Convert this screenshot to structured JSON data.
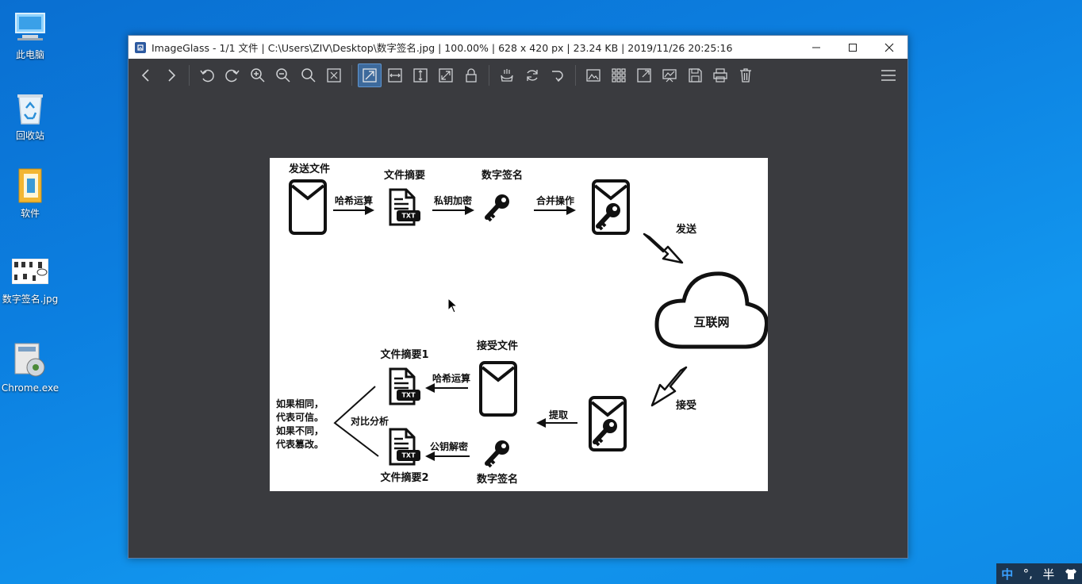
{
  "desktop": {
    "icons": [
      {
        "label": "此电脑"
      },
      {
        "label": "回收站"
      },
      {
        "label": "软件"
      },
      {
        "label": "数字签名.jpg"
      },
      {
        "label": "Chrome.exe"
      }
    ]
  },
  "window": {
    "title": "ImageGlass - 1/1 文件  |  C:\\Users\\ZIV\\Desktop\\数字签名.jpg  |  100.00%  |  628 x 420 px  |  23.24 KB  |  2019/11/26 20:25:16"
  },
  "diagram": {
    "send_file": "发送文件",
    "digest": "文件摘要",
    "signature": "数字签名",
    "hash_op": "哈希运算",
    "private_key_enc": "私钥加密",
    "merge_op": "合并操作",
    "send": "发送",
    "internet": "互联网",
    "receive": "接受",
    "extract": "提取",
    "received_file": "接受文件",
    "hash_op2": "哈希运算",
    "digest1": "文件摘要1",
    "public_key_dec": "公钥解密",
    "signature2": "数字签名",
    "digest2": "文件摘要2",
    "compare": "对比分析",
    "result_1": "如果相同，",
    "result_2": "代表可信。",
    "result_3": "如果不同，",
    "result_4": "代表篡改。",
    "txt": "TXT"
  },
  "tray": {
    "ime": "中",
    "punct": "°,",
    "width": "半"
  }
}
